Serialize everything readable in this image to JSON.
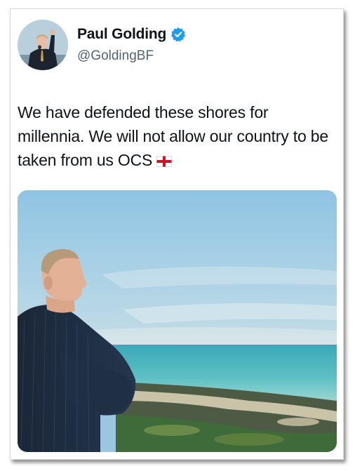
{
  "tweet": {
    "display_name": "Paul Golding",
    "handle": "@GoldingBF",
    "text": "We have defended these shores for millennia. We will not allow our country to be taken from us OCS",
    "flag_emoji": "england-flag-icon"
  },
  "colors": {
    "verified_badge": "#1d9bf0",
    "name_text": "#0f1419",
    "handle_text": "#536471"
  }
}
